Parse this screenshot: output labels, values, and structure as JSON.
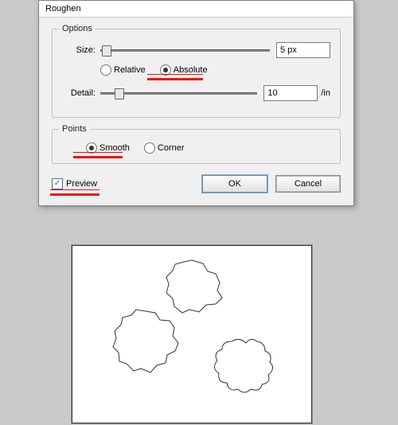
{
  "dialog": {
    "title": "Roughen",
    "options": {
      "legend": "Options",
      "size_label": "Size:",
      "size_value": "5 px",
      "relative_label": "Relative",
      "absolute_label": "Absolute",
      "size_mode": "absolute",
      "detail_label": "Detail:",
      "detail_value": "10",
      "detail_unit": "/in"
    },
    "points": {
      "legend": "Points",
      "smooth_label": "Smooth",
      "corner_label": "Corner",
      "mode": "smooth"
    },
    "preview_label": "Preview",
    "preview_checked": true,
    "ok_label": "OK",
    "cancel_label": "Cancel"
  }
}
